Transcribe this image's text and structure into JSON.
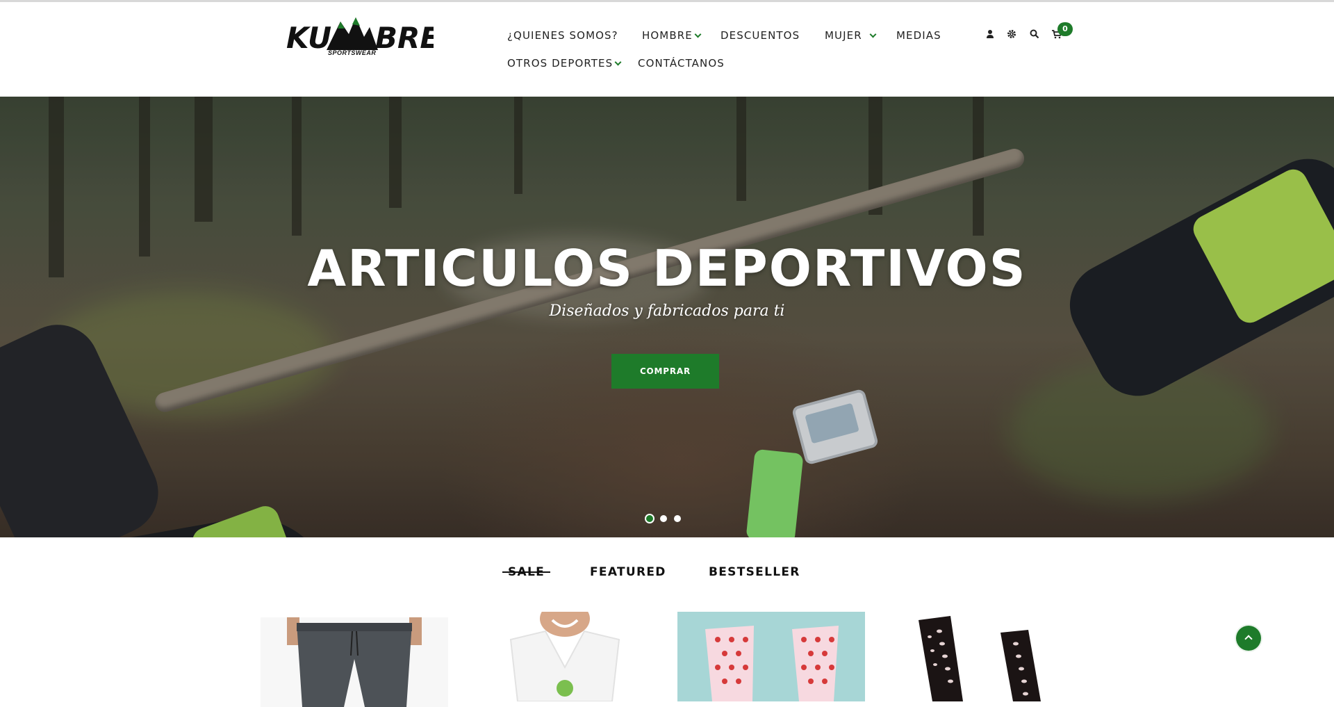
{
  "brand": {
    "logo_text": "KUMBRE",
    "logo_sub": "SPORTSWEAR",
    "colors": {
      "accent": "#1e7b2a",
      "text": "#222222"
    }
  },
  "nav": {
    "items": [
      {
        "label": "¿QUIENES SOMOS?",
        "dropdown": false
      },
      {
        "label": "HOMBRE",
        "dropdown": true
      },
      {
        "label": "DESCUENTOS",
        "dropdown": false
      },
      {
        "label": "MUJER",
        "dropdown": true
      },
      {
        "label": "MEDIAS",
        "dropdown": false
      },
      {
        "label": "OTROS DEPORTES",
        "dropdown": true
      },
      {
        "label": "CONTÁCTANOS",
        "dropdown": false
      }
    ]
  },
  "header_icons": {
    "user": "user-icon",
    "settings": "gear-icon",
    "search": "search-icon",
    "cart": "cart-icon",
    "cart_count": "0"
  },
  "hero": {
    "title": "ARTICULOS DEPORTIVOS",
    "subtitle": "Diseñados y fabricados para ti",
    "button_label": "COMPRAR",
    "slides_total": 3,
    "active_slide": 1
  },
  "tabs": [
    {
      "label": "SALE",
      "active": true
    },
    {
      "label": "FEATURED",
      "active": false
    },
    {
      "label": "BESTSELLER",
      "active": false
    }
  ],
  "products": [
    {
      "image": "gray-jogger-shorts"
    },
    {
      "image": "white-v-neck-tee"
    },
    {
      "image": "pink-socks-red-dots"
    },
    {
      "image": "black-socks-white-dots"
    }
  ],
  "scroll_top_icon": "chevron-up-icon"
}
